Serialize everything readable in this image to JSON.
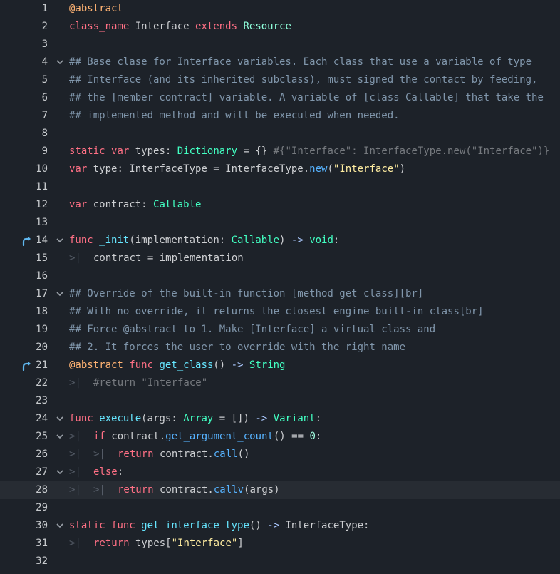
{
  "editor": {
    "lines": [
      {
        "n": "1",
        "fold": false,
        "override": false,
        "current": false,
        "segs": [
          [
            "ann",
            "@abstract"
          ]
        ]
      },
      {
        "n": "2",
        "fold": false,
        "override": false,
        "current": false,
        "segs": [
          [
            "kw",
            "class_name"
          ],
          [
            "",
            " Interface "
          ],
          [
            "kw",
            "extends"
          ],
          [
            "",
            " "
          ],
          [
            "eng",
            "Resource"
          ]
        ]
      },
      {
        "n": "3",
        "fold": false,
        "override": false,
        "current": false,
        "segs": []
      },
      {
        "n": "4",
        "fold": true,
        "override": false,
        "current": false,
        "segs": [
          [
            "doc",
            "## Base clase for Interface variables. Each class that use a variable of type"
          ]
        ]
      },
      {
        "n": "5",
        "fold": false,
        "override": false,
        "current": false,
        "segs": [
          [
            "doc",
            "## Interface (and its inherited subclass), must signed the contact by feeding,"
          ]
        ]
      },
      {
        "n": "6",
        "fold": false,
        "override": false,
        "current": false,
        "segs": [
          [
            "doc",
            "## the [member contract] variable. A variable of [class Callable] that take the"
          ]
        ]
      },
      {
        "n": "7",
        "fold": false,
        "override": false,
        "current": false,
        "segs": [
          [
            "doc",
            "## implemented method and will be executed when needed."
          ]
        ]
      },
      {
        "n": "8",
        "fold": false,
        "override": false,
        "current": false,
        "segs": []
      },
      {
        "n": "9",
        "fold": false,
        "override": false,
        "current": false,
        "segs": [
          [
            "kw",
            "static"
          ],
          [
            "",
            " "
          ],
          [
            "kw",
            "var"
          ],
          [
            "",
            " types: "
          ],
          [
            "ty",
            "Dictionary"
          ],
          [
            "",
            " = {} "
          ],
          [
            "cm",
            "#{\"Interface\": InterfaceType.new(\"Interface\")}"
          ]
        ]
      },
      {
        "n": "10",
        "fold": false,
        "override": false,
        "current": false,
        "segs": [
          [
            "kw",
            "var"
          ],
          [
            "",
            " type: InterfaceType = InterfaceType."
          ],
          [
            "fn",
            "new"
          ],
          [
            "",
            "("
          ],
          [
            "str",
            "\"Interface\""
          ],
          [
            "",
            ")"
          ]
        ]
      },
      {
        "n": "11",
        "fold": false,
        "override": false,
        "current": false,
        "segs": []
      },
      {
        "n": "12",
        "fold": false,
        "override": false,
        "current": false,
        "segs": [
          [
            "kw",
            "var"
          ],
          [
            "",
            " contract: "
          ],
          [
            "ty",
            "Callable"
          ]
        ]
      },
      {
        "n": "13",
        "fold": false,
        "override": false,
        "current": false,
        "segs": []
      },
      {
        "n": "14",
        "fold": true,
        "override": true,
        "current": false,
        "segs": [
          [
            "kw",
            "func"
          ],
          [
            "",
            " "
          ],
          [
            "def",
            "_init"
          ],
          [
            "",
            "(implementation: "
          ],
          [
            "ty",
            "Callable"
          ],
          [
            "",
            ") "
          ],
          [
            "sym",
            "->"
          ],
          [
            "",
            " "
          ],
          [
            "ty",
            "void"
          ],
          [
            "",
            ":"
          ]
        ]
      },
      {
        "n": "15",
        "fold": false,
        "override": false,
        "current": false,
        "segs": [
          [
            "tab",
            ">|"
          ],
          [
            "",
            "contract = implementation"
          ]
        ]
      },
      {
        "n": "16",
        "fold": false,
        "override": false,
        "current": false,
        "segs": []
      },
      {
        "n": "17",
        "fold": true,
        "override": false,
        "current": false,
        "segs": [
          [
            "doc",
            "## Override of the built-in function [method get_class][br]"
          ]
        ]
      },
      {
        "n": "18",
        "fold": false,
        "override": false,
        "current": false,
        "segs": [
          [
            "doc",
            "## With no override, it returns the closest engine built-in class[br]"
          ]
        ]
      },
      {
        "n": "19",
        "fold": false,
        "override": false,
        "current": false,
        "segs": [
          [
            "doc",
            "## Force @abstract to 1. Make [Interface] a virtual class and"
          ]
        ]
      },
      {
        "n": "20",
        "fold": false,
        "override": false,
        "current": false,
        "segs": [
          [
            "doc",
            "## 2. It forces the user to override with the right name"
          ]
        ]
      },
      {
        "n": "21",
        "fold": false,
        "override": true,
        "current": false,
        "segs": [
          [
            "ann",
            "@abstract"
          ],
          [
            "",
            " "
          ],
          [
            "kw",
            "func"
          ],
          [
            "",
            " "
          ],
          [
            "def",
            "get_class"
          ],
          [
            "",
            "() "
          ],
          [
            "sym",
            "->"
          ],
          [
            "",
            " "
          ],
          [
            "ty",
            "String"
          ]
        ]
      },
      {
        "n": "22",
        "fold": false,
        "override": false,
        "current": false,
        "segs": [
          [
            "tab",
            ">|"
          ],
          [
            "cm",
            "#return \"Interface\""
          ]
        ]
      },
      {
        "n": "23",
        "fold": false,
        "override": false,
        "current": false,
        "segs": []
      },
      {
        "n": "24",
        "fold": true,
        "override": false,
        "current": false,
        "segs": [
          [
            "kw",
            "func"
          ],
          [
            "",
            " "
          ],
          [
            "def",
            "execute"
          ],
          [
            "",
            "(args: "
          ],
          [
            "ty",
            "Array"
          ],
          [
            "",
            " = []) "
          ],
          [
            "sym",
            "->"
          ],
          [
            "",
            " "
          ],
          [
            "ty",
            "Variant"
          ],
          [
            "",
            ":"
          ]
        ]
      },
      {
        "n": "25",
        "fold": true,
        "override": false,
        "current": false,
        "segs": [
          [
            "tab",
            ">|"
          ],
          [
            "kw",
            "if"
          ],
          [
            "",
            " contract."
          ],
          [
            "fn",
            "get_argument_count"
          ],
          [
            "",
            "() == "
          ],
          [
            "num",
            "0"
          ],
          [
            "",
            ":"
          ]
        ]
      },
      {
        "n": "26",
        "fold": false,
        "override": false,
        "current": false,
        "segs": [
          [
            "tab",
            ">|"
          ],
          [
            "tab",
            ">|"
          ],
          [
            "kw",
            "return"
          ],
          [
            "",
            " contract."
          ],
          [
            "fn",
            "call"
          ],
          [
            "",
            "()"
          ]
        ]
      },
      {
        "n": "27",
        "fold": true,
        "override": false,
        "current": false,
        "segs": [
          [
            "tab",
            ">|"
          ],
          [
            "kw",
            "else"
          ],
          [
            "",
            ":"
          ]
        ]
      },
      {
        "n": "28",
        "fold": false,
        "override": false,
        "current": true,
        "segs": [
          [
            "tab",
            ">|"
          ],
          [
            "tab",
            ">|"
          ],
          [
            "kw",
            "return"
          ],
          [
            "",
            " contract."
          ],
          [
            "fn",
            "callv"
          ],
          [
            "",
            "(args)"
          ]
        ]
      },
      {
        "n": "29",
        "fold": false,
        "override": false,
        "current": false,
        "segs": []
      },
      {
        "n": "30",
        "fold": true,
        "override": false,
        "current": false,
        "segs": [
          [
            "kw",
            "static"
          ],
          [
            "",
            " "
          ],
          [
            "kw",
            "func"
          ],
          [
            "",
            " "
          ],
          [
            "def",
            "get_interface_type"
          ],
          [
            "",
            "() "
          ],
          [
            "sym",
            "->"
          ],
          [
            "",
            " InterfaceType:"
          ]
        ]
      },
      {
        "n": "31",
        "fold": false,
        "override": false,
        "current": false,
        "segs": [
          [
            "tab",
            ">|"
          ],
          [
            "kw",
            "return"
          ],
          [
            "",
            " types["
          ],
          [
            "str",
            "\"Interface\""
          ],
          [
            "",
            "]"
          ]
        ]
      },
      {
        "n": "32",
        "fold": false,
        "override": false,
        "current": false,
        "segs": []
      }
    ]
  },
  "icons": {
    "fold": "chevron-down-icon",
    "override": "override-arrow-icon",
    "tab": "tab-indent-icon"
  },
  "colors": {
    "background": "#1d2229",
    "current_line": "#272c33",
    "keyword": "#ff7085",
    "annotation": "#ffb373",
    "type": "#42ffc2",
    "function": "#57b3ff",
    "string": "#ffeda1",
    "override_icon": "#5fb8f0"
  }
}
